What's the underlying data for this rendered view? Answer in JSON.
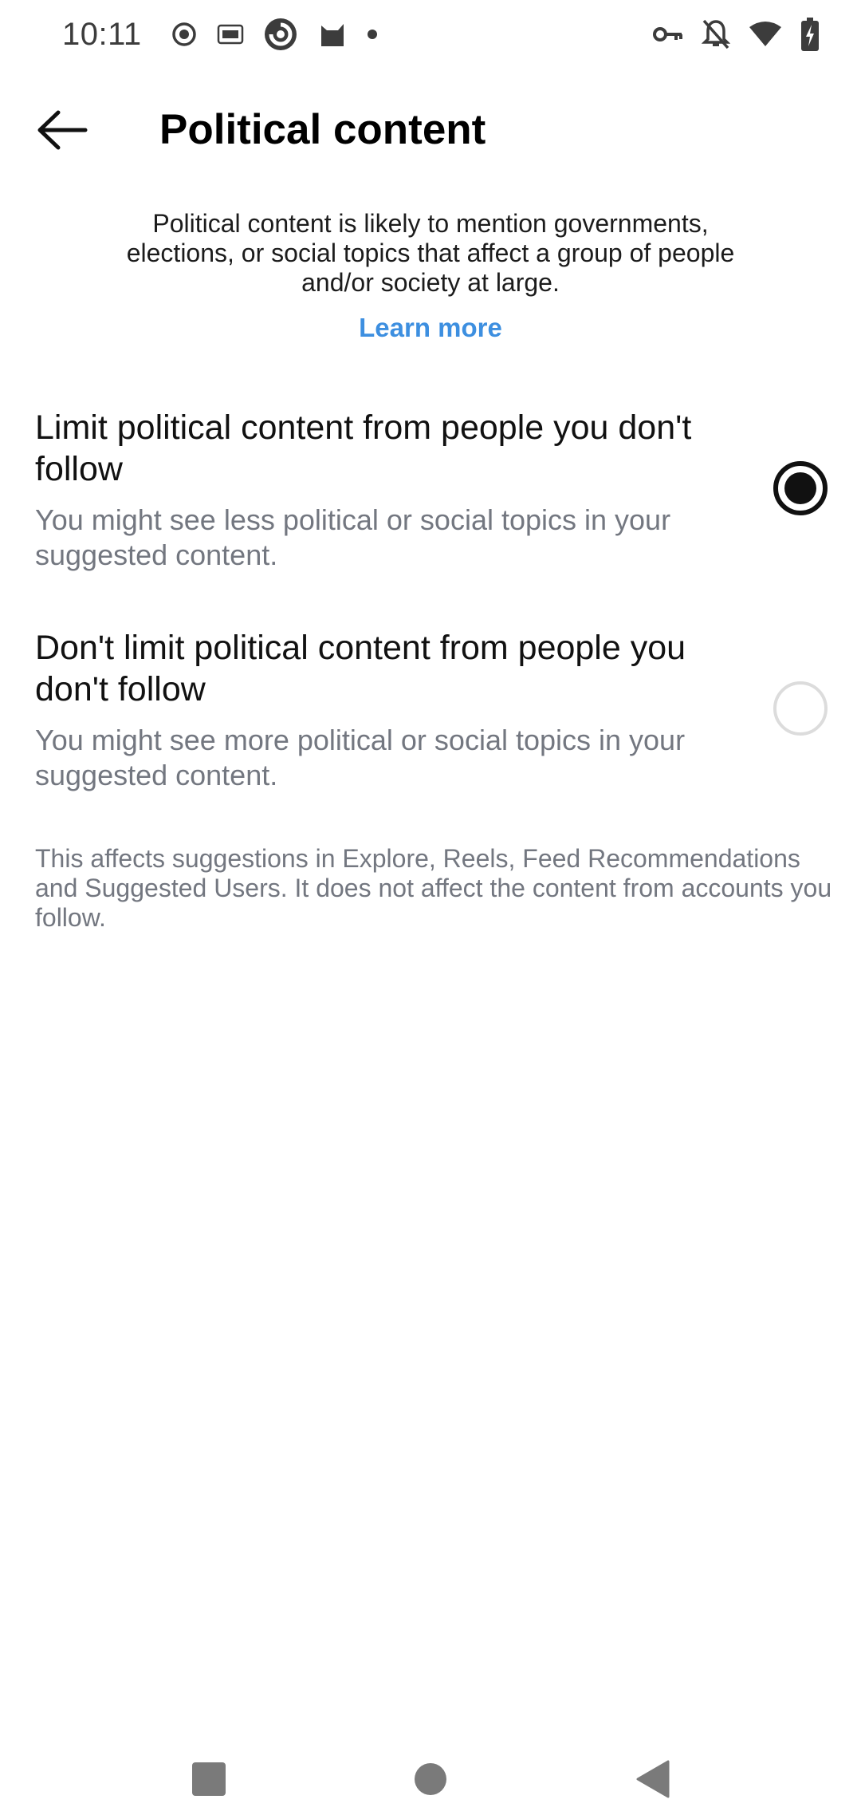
{
  "status_bar": {
    "time": "10:11",
    "left_icons": [
      "record-icon",
      "iqiyi-icon",
      "browser-icon",
      "cat-app-icon",
      "dot-icon"
    ],
    "right_icons": [
      "vpn-key-icon",
      "notifications-off-icon",
      "wifi-icon",
      "battery-charging-icon"
    ]
  },
  "header": {
    "title": "Political content",
    "back_icon": "arrow-left-icon"
  },
  "intro": {
    "text": "Political content is likely to mention governments, elections, or social topics that affect a group of people and/or society at large.",
    "learn_more": "Learn more",
    "link_color": "#3d8fe0"
  },
  "options": [
    {
      "title": "Limit political content from people you don't follow",
      "description": "You might see less political or social topics in your suggested content.",
      "selected": true
    },
    {
      "title": "Don't limit political content from people you don't follow",
      "description": "You might see more political or social topics in your suggested content.",
      "selected": false
    }
  ],
  "footnote": "This affects suggestions in Explore, Reels, Feed Recommendations and Suggested Users. It does not affect the content from accounts you follow.",
  "nav_bar": {
    "buttons": [
      "recents-square-icon",
      "home-circle-icon",
      "back-triangle-icon"
    ]
  }
}
